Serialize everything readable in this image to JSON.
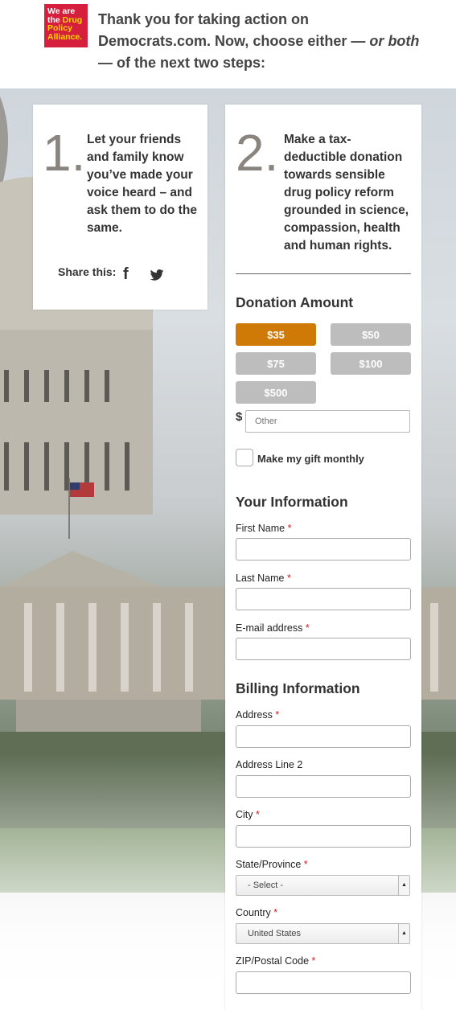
{
  "logo": {
    "line1": "We are",
    "line2a": "the",
    "line2b": "Drug",
    "line3": "Policy",
    "line4": "Alliance."
  },
  "headline": {
    "part1": "Thank you for taking action on Democrats.com. Now, choose either — ",
    "italic1": "or",
    "part2": " ",
    "italic2": "both",
    "part3": " — of the next two steps:"
  },
  "step1": {
    "number": "1.",
    "text": "Let your friends and family know you’ve made your voice heard – and ask them to do the same.",
    "share_label": "Share this:",
    "facebook_icon": "f"
  },
  "step2": {
    "number": "2.",
    "text": "Make a tax-deductible donation towards sensible drug policy reform grounded in science, compassion, health and human rights."
  },
  "donation": {
    "title": "Donation Amount",
    "amounts": [
      "$35",
      "$50",
      "$75",
      "$100",
      "$500"
    ],
    "selected": "$35",
    "accent_color": "#cf7a07",
    "currency_symbol": "$",
    "other_placeholder": "Other",
    "monthly_label": "Make my gift monthly"
  },
  "your_info": {
    "title": "Your Information",
    "first_name": "First Name",
    "last_name": "Last Name",
    "email": "E-mail address",
    "required_mark": "*"
  },
  "billing": {
    "title": "Billing Information",
    "address": "Address",
    "address2": "Address Line 2",
    "city": "City",
    "state": "State/Province",
    "state_value": "- Select -",
    "country": "Country",
    "country_value": "United States",
    "zip": "ZIP/Postal Code"
  }
}
